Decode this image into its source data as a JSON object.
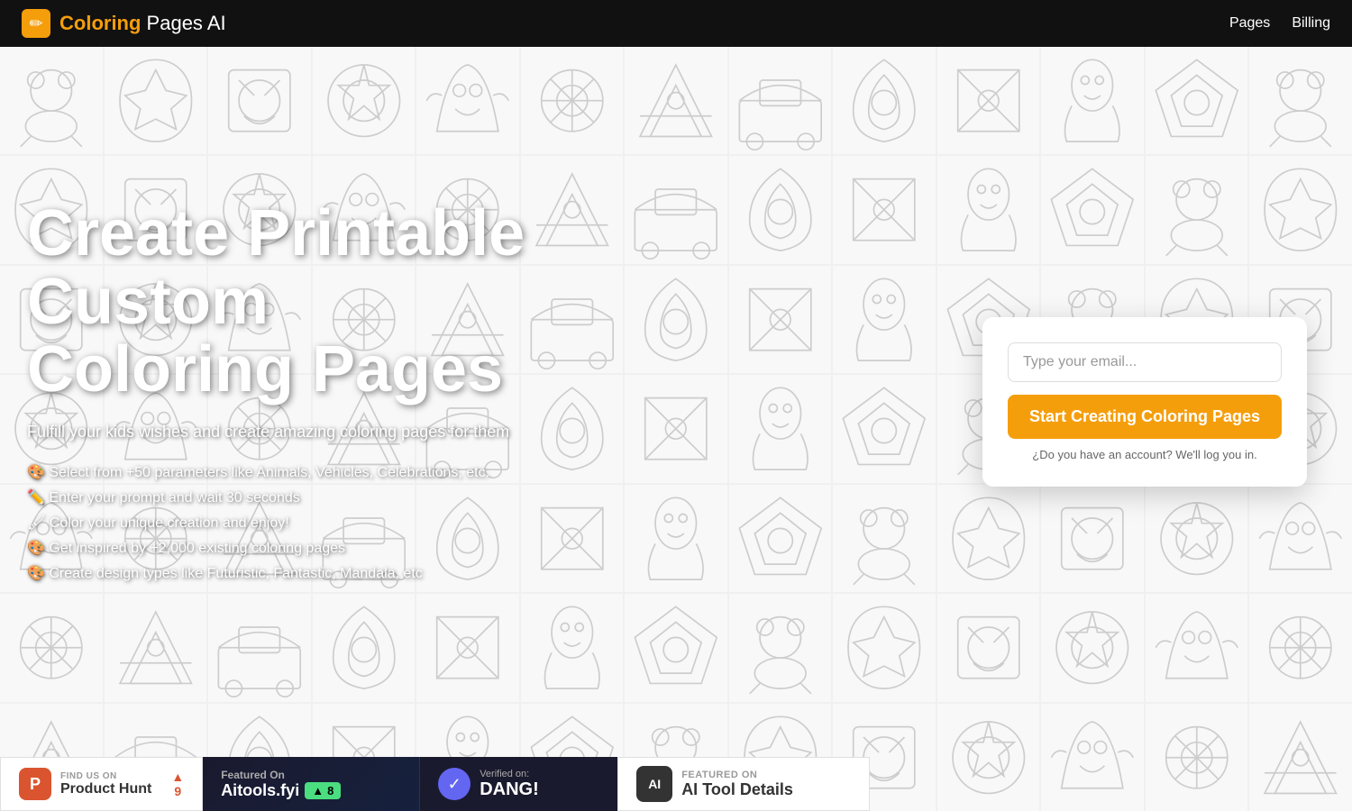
{
  "nav": {
    "logo_text_bold": "Coloring",
    "logo_text_regular": " Pages AI",
    "logo_icon": "✏",
    "links": [
      {
        "label": "Pages",
        "id": "pages-link"
      },
      {
        "label": "Billing",
        "id": "billing-link"
      }
    ]
  },
  "hero": {
    "title_line1": "Create Printable Custom",
    "title_line2": "Coloring Pages",
    "subtitle": "Fulfill your kids wishes and create amazing coloring pages for them",
    "features": [
      "🎨 Select from +50 parameters like Animals, Vehicles, Celebrations, etc.",
      "✏️ Enter your prompt and wait 30 seconds",
      "🖌 Color your unique creation and enjoy!",
      "🎨 Get inspired by +2,000 existing coloring pages",
      "🎨 Create design types like Futuristic, Fantastic, Mandala, etc"
    ]
  },
  "card": {
    "email_placeholder": "Type your email...",
    "cta_label": "Start Creating Coloring Pages",
    "login_text": "¿Do you have an account? We'll log you in."
  },
  "badges": {
    "product_hunt": {
      "find_label": "FIND US ON",
      "name": "Product Hunt",
      "score": "9",
      "arrow": "▲"
    },
    "aitools": {
      "featured_on": "Featured On",
      "brand": "Aitools.fyi",
      "score": "8",
      "icon": "▲"
    },
    "dang": {
      "verified_on": "Verified on:",
      "brand": "DANG!"
    },
    "ai_tool_details": {
      "featured_on": "FEATURED ON",
      "name": "AI Tool Details"
    }
  },
  "colors": {
    "accent": "#f59e0b",
    "nav_bg": "#111111",
    "card_bg": "#ffffff",
    "cta_bg": "#f59e0b",
    "ph_orange": "#da552f",
    "dang_purple": "#6366f1"
  }
}
